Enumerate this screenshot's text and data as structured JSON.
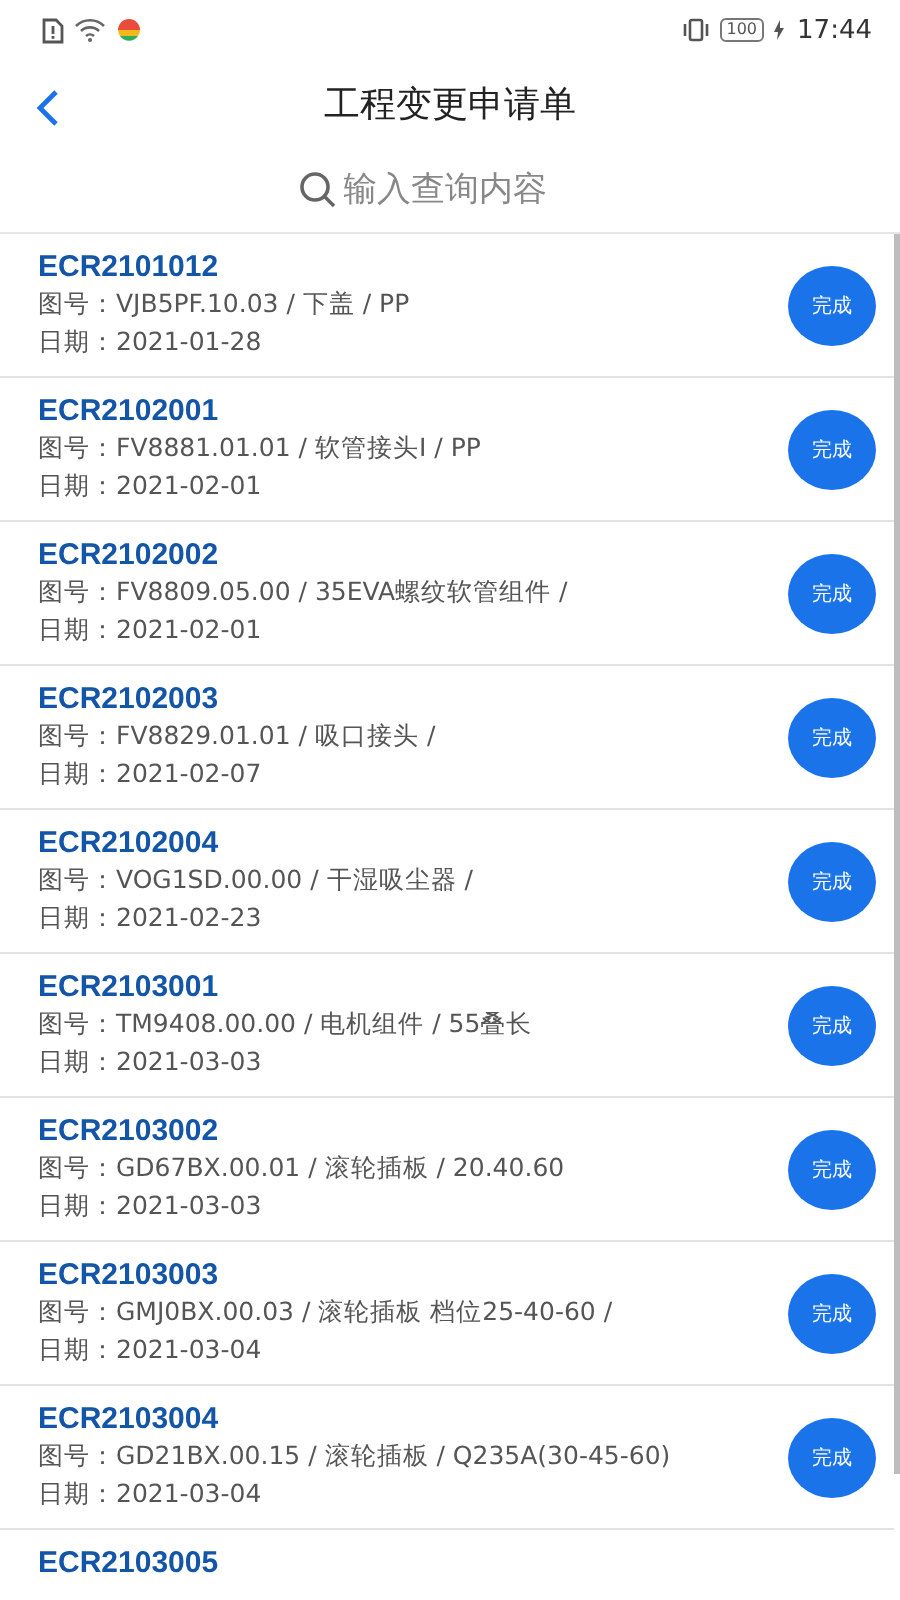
{
  "status_bar": {
    "battery": "100",
    "time": "17:44"
  },
  "header": {
    "title": "工程变更申请单"
  },
  "search": {
    "placeholder": "输入查询内容"
  },
  "records": [
    {
      "code": "ECR2101012",
      "drawing_label": "图号：",
      "drawing": "VJB5PF.10.03 / 下盖 / PP",
      "date_label": "日期：",
      "date": "2021-01-28",
      "status": "完成"
    },
    {
      "code": "ECR2102001",
      "drawing_label": "图号：",
      "drawing": "FV8881.01.01 / 软管接头I / PP",
      "date_label": "日期：",
      "date": "2021-02-01",
      "status": "完成"
    },
    {
      "code": "ECR2102002",
      "drawing_label": "图号：",
      "drawing": "FV8809.05.00 / 35EVA螺纹软管组件 /",
      "date_label": "日期：",
      "date": "2021-02-01",
      "status": "完成"
    },
    {
      "code": "ECR2102003",
      "drawing_label": "图号：",
      "drawing": "FV8829.01.01 / 吸口接头 /",
      "date_label": "日期：",
      "date": "2021-02-07",
      "status": "完成"
    },
    {
      "code": "ECR2102004",
      "drawing_label": "图号：",
      "drawing": "VOG1SD.00.00 / 干湿吸尘器 /",
      "date_label": "日期：",
      "date": "2021-02-23",
      "status": "完成"
    },
    {
      "code": "ECR2103001",
      "drawing_label": "图号：",
      "drawing": "TM9408.00.00 / 电机组件 / 55叠长",
      "date_label": "日期：",
      "date": "2021-03-03",
      "status": "完成"
    },
    {
      "code": "ECR2103002",
      "drawing_label": "图号：",
      "drawing": "GD67BX.00.01 / 滚轮插板 / 20.40.60",
      "date_label": "日期：",
      "date": "2021-03-03",
      "status": "完成"
    },
    {
      "code": "ECR2103003",
      "drawing_label": "图号：",
      "drawing": "GMJ0BX.00.03 / 滚轮插板 档位25-40-60 /",
      "date_label": "日期：",
      "date": "2021-03-04",
      "status": "完成"
    },
    {
      "code": "ECR2103004",
      "drawing_label": "图号：",
      "drawing": "GD21BX.00.15 / 滚轮插板 / Q235A(30-45-60)",
      "date_label": "日期：",
      "date": "2021-03-04",
      "status": "完成"
    },
    {
      "code": "ECR2103005"
    }
  ]
}
